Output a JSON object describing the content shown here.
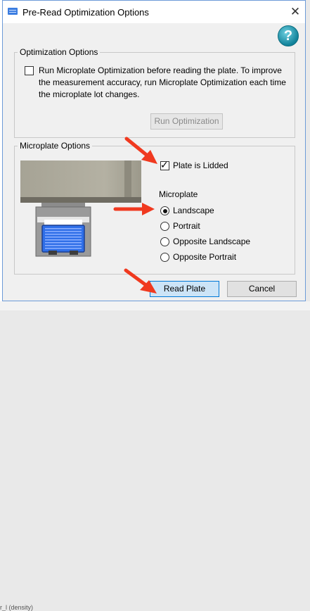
{
  "window": {
    "title": "Pre-Read Optimization Options",
    "close_glyph": "✕",
    "help_glyph": "?"
  },
  "optimization": {
    "group_label": "Optimization Options",
    "checkbox_line1": "Run Microplate Optimization before reading the plate. To improve",
    "checkbox_line2": "the measurement accuracy, run Microplate Optimization each time",
    "checkbox_line3": "the microplate lot changes.",
    "checked": false,
    "run_button": "Run Optimization"
  },
  "microplate": {
    "group_label": "Microplate Options",
    "lidded_label": "Plate is Lidded",
    "lidded_checked": true,
    "orientation_label": "Microplate",
    "options": [
      "Landscape",
      "Portrait",
      "Opposite Landscape",
      "Opposite Portrait"
    ],
    "selected": "Landscape"
  },
  "buttons": {
    "read": "Read Plate",
    "cancel": "Cancel"
  },
  "background": {
    "bottom_text": "r_l  (density)"
  },
  "colors": {
    "arrow": "#f0391f",
    "plate": "#2f6fe8",
    "primary_border": "#0078d7"
  },
  "icons": [
    "app-icon",
    "close-icon",
    "help-icon",
    "arrow-icon"
  ]
}
